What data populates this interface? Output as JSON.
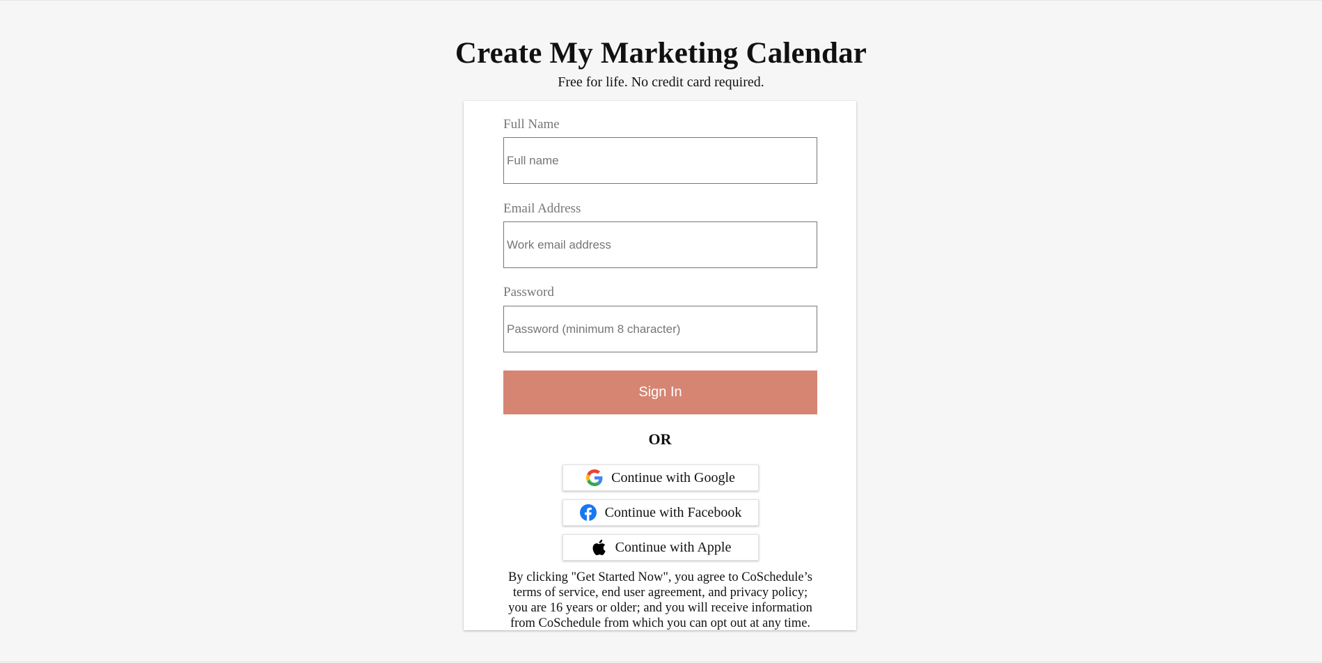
{
  "header": {
    "title": "Create My Marketing Calendar",
    "subtitle": "Free for life. No credit card required."
  },
  "form": {
    "full_name": {
      "label": "Full Name",
      "placeholder": "Full name",
      "value": ""
    },
    "email": {
      "label": "Email Address",
      "placeholder": "Work email address",
      "value": ""
    },
    "password": {
      "label": "Password",
      "placeholder": "Password (minimum 8 character)",
      "value": ""
    },
    "submit_label": "Sign In",
    "or_label": "OR"
  },
  "social": [
    {
      "label": "Continue with Google",
      "icon": "google-icon"
    },
    {
      "label": "Continue with Facebook",
      "icon": "facebook-icon"
    },
    {
      "label": "Continue with Apple",
      "icon": "apple-icon"
    }
  ],
  "legal": {
    "text": "By clicking \"Get Started Now\", you agree to CoSchedule’s terms of service, end user agreement, and privacy policy; you are 16 years or older; and you will receive information from CoSchedule from which you can opt out at any time."
  },
  "colors": {
    "page_background": "#f6f6f6",
    "card_background": "#ffffff",
    "button_accent": "#d58572",
    "label_gray": "#777777",
    "facebook_blue": "#1877f2"
  }
}
